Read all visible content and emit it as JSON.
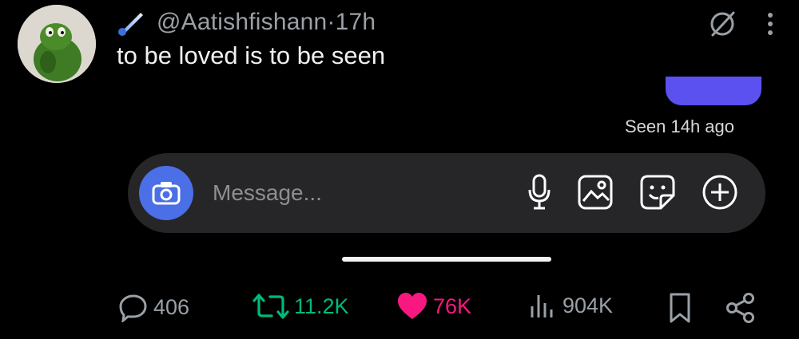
{
  "post": {
    "handle": "@Aatishfishann",
    "separator": " · ",
    "time": "17h",
    "text": "to be loved is to be seen"
  },
  "dm_preview": {
    "seen_text": "Seen 14h ago",
    "message_placeholder": "Message...",
    "bubble_color": "#5b51f0",
    "camera_button_color": "#4b6fe6"
  },
  "stats": {
    "replies": "406",
    "reposts": "11.2K",
    "likes": "76K",
    "views": "904K"
  },
  "colors": {
    "background": "#000000",
    "repost_green": "#00ba7c",
    "like_pink": "#f91880",
    "muted": "#9aa0a6"
  },
  "icons": [
    "comet-emoji",
    "grok-icon",
    "more-icon",
    "camera-icon",
    "mic-icon",
    "gallery-icon",
    "sticker-icon",
    "plus-icon",
    "reply-icon",
    "repost-icon",
    "heart-icon",
    "views-icon",
    "bookmark-icon",
    "share-icon"
  ]
}
